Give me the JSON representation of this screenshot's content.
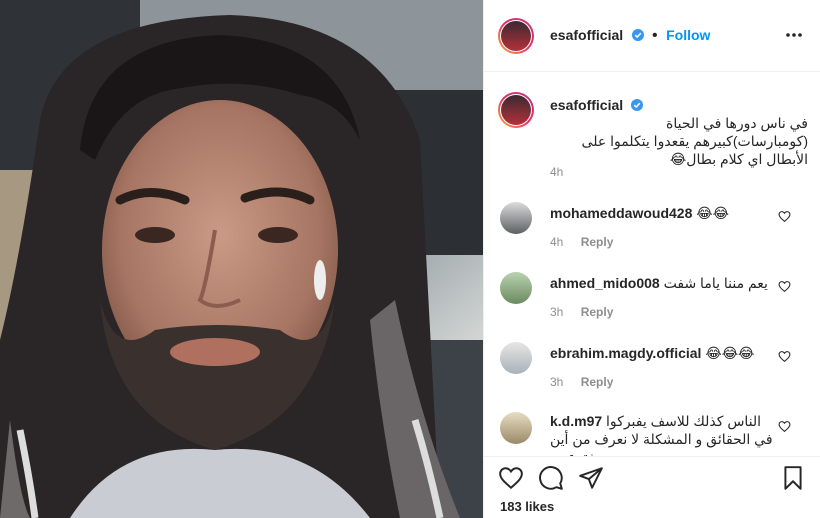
{
  "post": {
    "username": "esafofficial",
    "follow_label": "Follow",
    "separator": "•",
    "caption": "في ناس دورها في الحياة (كومبارسات)كبيرهم يقعدوا يتكلموا على الأبطال اي كلام بطال😂",
    "caption_time": "4h",
    "likes": "183 likes"
  },
  "comments": [
    {
      "username": "mohameddawoud428",
      "text": "😂😂",
      "time": "4h",
      "reply_label": "Reply"
    },
    {
      "username": "ahmed_mido008",
      "text": "يعم مننا ياما شفت",
      "time": "3h",
      "reply_label": "Reply"
    },
    {
      "username": "ebrahim.magdy.official",
      "text": "😂😂😂",
      "time": "3h",
      "reply_label": "Reply"
    },
    {
      "username": "k.d.m97",
      "text": "الناس كذلك للاسف يفبركوا في الحقائق و المشكلة لا نعرف من أين يخترعون",
      "time": "",
      "reply_label": ""
    }
  ],
  "colors": {
    "link_blue": "#0095f6",
    "text": "#262626",
    "muted": "#8e8e8e",
    "border": "#efefef"
  },
  "icons": [
    "verified-badge-icon",
    "more-options-icon",
    "heart-icon",
    "comment-icon",
    "share-icon",
    "save-bookmark-icon"
  ]
}
